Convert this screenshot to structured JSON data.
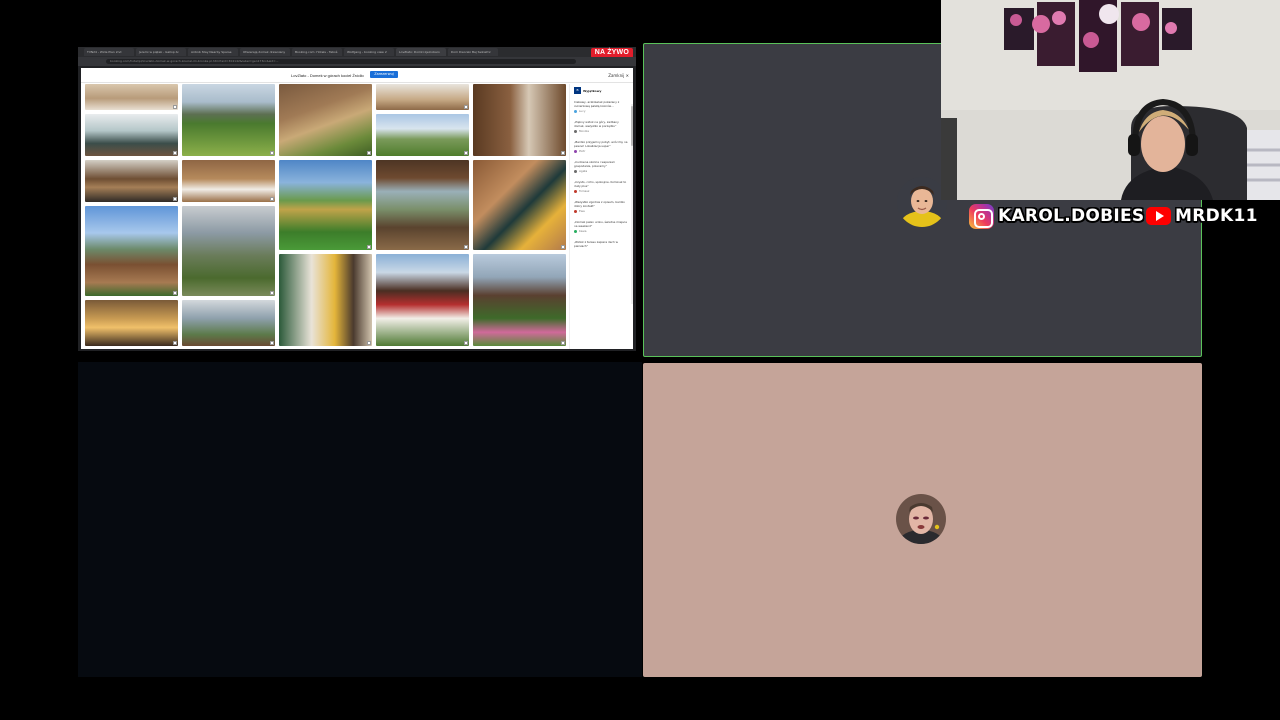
{
  "browser": {
    "tabs": [
      "TVN24 - Wide Plan 2nd",
      "Jeremi w piątek - Gallop.tv",
      "Airbnb Stay Nearby Sparse",
      "Otwierają domek drewniany",
      "Booking.com: Hotels - Taboš",
      "Wolfgang - booking view 2",
      "LovZlato: Domki zjelcobaro",
      "Dom Dworski Baj Ssikiefcz"
    ],
    "url": "booking.com/hotel/pl/lovzlato-domek-w-gorach-kosciel-im-bronka.pl.html?aid=304142&label=gen173nr&sid=...",
    "live_badge": "NA ŻYWO"
  },
  "page": {
    "title": "LovZlato - Domek w górach kocieł Źródło",
    "reserve_label": "Zarezerwuj teraz",
    "close_label": "Zamknij ✕"
  },
  "reviews": {
    "site": "Wyjątkowy",
    "items": [
      {
        "text": "Ciekawy, aczkolwiek pokazany z cukierkową paletą kolorów…",
        "author": "Lucy",
        "color": "#4aa3df"
      },
      {
        "text": "„Piękny widok na góry, zadbany domek, wszystko w porządku”",
        "author": "Monika",
        "color": "#6c6c6c"
      },
      {
        "text": "„Bardzo przyjemny pobyt, wrócimy na pewno! Lokalizacja super”",
        "author": "Piotr",
        "color": "#6c6c6c"
      },
      {
        "text": "„Cudowna okolica i wspaniali gospodarze, polecamy”",
        "author": "Agata",
        "color": "#8e44ad"
      },
      {
        "text": "„Czysto, cicho, spokojnie. Kominek to duży plus”",
        "author": "Tomasz",
        "color": "#6c6c6c"
      },
      {
        "text": "„Wszystko zgodnie z opisem, bardzo dobry kontakt”",
        "author": "Ewa",
        "color": "#c0392b"
      },
      {
        "text": "„Domek pełen uroku, świetne miejsce na weekend”",
        "author": "Kasia",
        "color": "#c0392b"
      },
      {
        "text": "„Widok z tarasu zapiera dech w piersiach”",
        "author": "Marek",
        "color": "#27ae60"
      }
    ]
  },
  "overlays": {
    "instagram_handle": "KAROL.DOBIES",
    "youtube_handle": "MRDK11"
  },
  "tiles": {
    "active_speaker_color": "#5ac25a",
    "tile_bg_dark": "#3b3c43",
    "tile_bg_pink": "#c5a499"
  }
}
